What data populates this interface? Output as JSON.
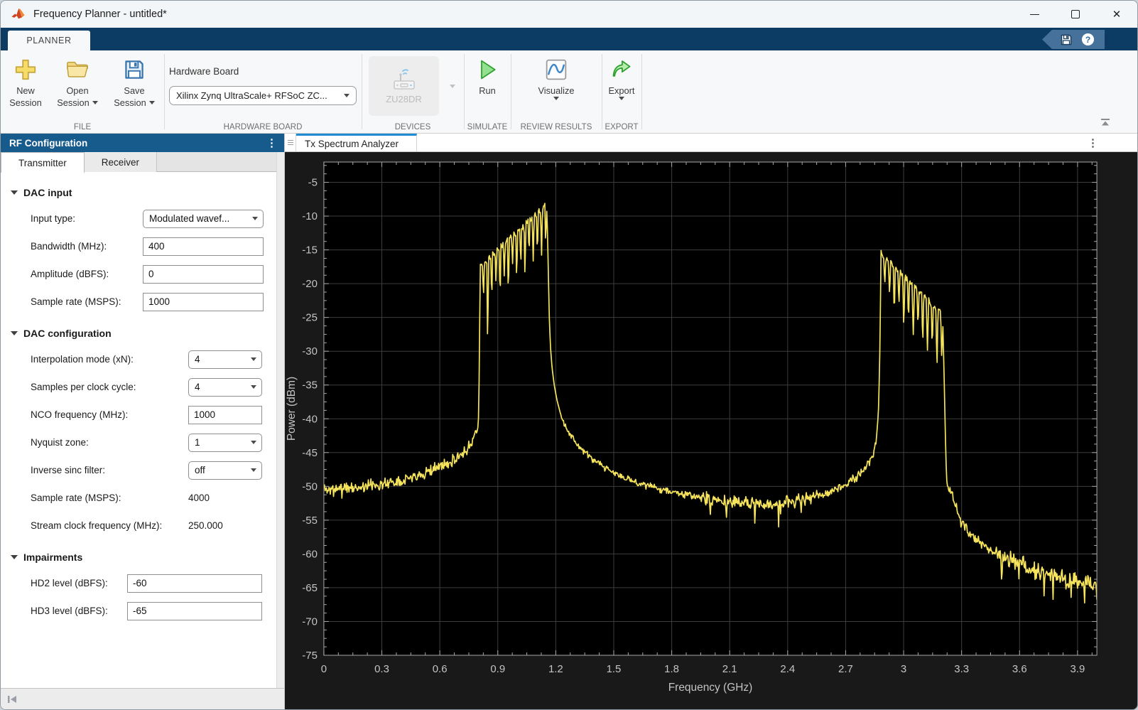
{
  "titlebar": {
    "title": "Frequency Planner - untitled*"
  },
  "ribbon": {
    "tab": "PLANNER",
    "groups": {
      "file": {
        "label": "FILE",
        "new_line1": "New",
        "new_line2": "Session",
        "open_line1": "Open",
        "open_line2": "Session",
        "save_line1": "Save",
        "save_line2": "Session"
      },
      "hardware": {
        "label": "HARDWARE BOARD",
        "field_label": "Hardware Board",
        "selected": "Xilinx Zynq UltraScale+ RFSoC ZC..."
      },
      "devices": {
        "label": "DEVICES",
        "device_name": "ZU28DR"
      },
      "simulate": {
        "label": "SIMULATE",
        "run_label": "Run"
      },
      "review_results": {
        "label": "REVIEW RESULTS",
        "visualize_label": "Visualize"
      },
      "export": {
        "label": "EXPORT",
        "export_label": "Export"
      }
    }
  },
  "left_panel": {
    "title": "RF Configuration",
    "tabs": [
      {
        "label": "Transmitter",
        "active": true
      },
      {
        "label": "Receiver",
        "active": false
      }
    ],
    "sections": [
      {
        "name": "dac-input",
        "title": "DAC input",
        "rows": [
          {
            "name": "input-type",
            "label": "Input type:",
            "type": "combo",
            "value": "Modulated wavef..."
          },
          {
            "name": "bandwidth-mhz",
            "label": "Bandwidth (MHz):",
            "type": "input",
            "value": "400"
          },
          {
            "name": "amplitude-dbfs",
            "label": "Amplitude (dBFS):",
            "type": "input",
            "value": "0"
          },
          {
            "name": "sample-rate-msps",
            "label": "Sample rate (MSPS):",
            "type": "input",
            "value": "1000"
          }
        ]
      },
      {
        "name": "dac-configuration",
        "title": "DAC configuration",
        "rows": [
          {
            "name": "interpolation-mode",
            "label": "Interpolation mode (xN):",
            "type": "combo",
            "value": "4"
          },
          {
            "name": "samples-per-clock-cycle",
            "label": "Samples per clock cycle:",
            "type": "combo",
            "value": "4"
          },
          {
            "name": "nco-frequency-mhz",
            "label": "NCO frequency (MHz):",
            "type": "input",
            "value": "1000"
          },
          {
            "name": "nyquist-zone",
            "label": "Nyquist zone:",
            "type": "combo",
            "value": "1"
          },
          {
            "name": "inverse-sinc-filter",
            "label": "Inverse sinc filter:",
            "type": "combo",
            "value": "off"
          },
          {
            "name": "dac-sample-rate-msps",
            "label": "Sample rate (MSPS):",
            "type": "static",
            "value": "4000"
          },
          {
            "name": "stream-clock-frequency-mhz",
            "label": "Stream clock frequency (MHz):",
            "type": "static",
            "value": "250.000"
          }
        ]
      },
      {
        "name": "impairments",
        "title": "Impairments",
        "rows": [
          {
            "name": "hd2-level-dbfs",
            "label": "HD2 level (dBFS):",
            "type": "input",
            "value": "-60"
          },
          {
            "name": "hd3-level-dbfs",
            "label": "HD3 level (dBFS):",
            "type": "input",
            "value": "-65"
          }
        ]
      }
    ]
  },
  "spectrum_panel": {
    "tab": "Tx Spectrum Analyzer"
  },
  "colors": {
    "ribbon_bar": "#0c3c63",
    "panel_header": "#175a8c",
    "active_tab_accent": "#1e8bd2"
  },
  "chart_data": {
    "type": "line",
    "title": "",
    "xlabel": "Frequency (GHz)",
    "ylabel": "Power (dBm)",
    "xlim": [
      0,
      4.0
    ],
    "ylim": [
      -75,
      -2
    ],
    "xticks": [
      0,
      0.3,
      0.6,
      0.9,
      1.2,
      1.5,
      1.8,
      2.1,
      2.4,
      2.7,
      3,
      3.3,
      3.6,
      3.9
    ],
    "xtick_labels": [
      "0",
      "0.3",
      "0.6",
      "0.9",
      "1.2",
      "1.5",
      "1.8",
      "2.1",
      "2.4",
      "2.7",
      "3",
      "3.3",
      "3.6",
      "3.9"
    ],
    "yticks": [
      -5,
      -10,
      -15,
      -20,
      -25,
      -30,
      -35,
      -40,
      -45,
      -50,
      -55,
      -60,
      -65,
      -70,
      -75
    ],
    "minor_x_step": 0.075,
    "minor_y_step": 1.25,
    "grid": true,
    "legend": false,
    "colors": {
      "trace": "#f5e35c",
      "plot_bg": "#000000",
      "frame_bg": "#191919",
      "grid": "#3d3d3d",
      "axis": "#a8a8a8",
      "text": "#c4c4c4"
    },
    "series": [
      {
        "seed": 11,
        "envelope": [
          [
            0,
            -50.2
          ],
          [
            0.05,
            -50.6
          ],
          [
            0.1,
            -50.1
          ],
          [
            0.16,
            -50.3
          ],
          [
            0.22,
            -49.9
          ],
          [
            0.3,
            -49.6
          ],
          [
            0.38,
            -49.2
          ],
          [
            0.45,
            -48.6
          ],
          [
            0.52,
            -48.0
          ],
          [
            0.58,
            -47.3
          ],
          [
            0.64,
            -46.5
          ],
          [
            0.69,
            -45.7
          ],
          [
            0.72,
            -45.1
          ],
          [
            0.745,
            -44.3
          ],
          [
            0.757,
            -43.6
          ],
          [
            0.764,
            -43.8
          ],
          [
            0.774,
            -42.8
          ],
          [
            0.783,
            -42.2
          ],
          [
            0.79,
            -41.8
          ],
          [
            0.797,
            -41.3
          ],
          [
            0.801,
            -39.5
          ],
          [
            0.804,
            -33.0
          ],
          [
            0.807,
            -24.0
          ],
          [
            0.809,
            -17.6
          ],
          [
            1.152,
            -8.3
          ],
          [
            1.157,
            -12.0
          ],
          [
            1.162,
            -19.0
          ],
          [
            1.167,
            -25.5
          ],
          [
            1.173,
            -29.5
          ],
          [
            1.181,
            -32.5
          ],
          [
            1.192,
            -35.0
          ],
          [
            1.206,
            -37.2
          ],
          [
            1.225,
            -39.3
          ],
          [
            1.25,
            -41.0
          ],
          [
            1.285,
            -42.8
          ],
          [
            1.33,
            -44.4
          ],
          [
            1.39,
            -46.0
          ],
          [
            1.46,
            -47.4
          ],
          [
            1.55,
            -48.7
          ],
          [
            1.65,
            -49.7
          ],
          [
            1.77,
            -50.6
          ],
          [
            1.9,
            -51.4
          ],
          [
            2.03,
            -52.0
          ],
          [
            2.17,
            -52.5
          ],
          [
            2.3,
            -52.7
          ],
          [
            2.42,
            -52.3
          ],
          [
            2.52,
            -51.7
          ],
          [
            2.61,
            -50.9
          ],
          [
            2.69,
            -49.9
          ],
          [
            2.76,
            -48.6
          ],
          [
            2.81,
            -47.1
          ],
          [
            2.845,
            -45.2
          ],
          [
            2.862,
            -42.5
          ],
          [
            2.871,
            -38.0
          ],
          [
            2.877,
            -30.0
          ],
          [
            2.881,
            -21.0
          ],
          [
            2.883,
            -15.6
          ],
          [
            3.202,
            -24.8
          ],
          [
            3.206,
            -29.5
          ],
          [
            3.211,
            -35.5
          ],
          [
            3.215,
            -41.0
          ],
          [
            3.219,
            -46.0
          ],
          [
            3.224,
            -49.6
          ],
          [
            3.23,
            -50.3
          ],
          [
            3.24,
            -50.6
          ],
          [
            3.25,
            -51.3
          ],
          [
            3.262,
            -52.4
          ],
          [
            3.278,
            -53.9
          ],
          [
            3.295,
            -55.1
          ],
          [
            3.315,
            -56.0
          ],
          [
            3.35,
            -57.1
          ],
          [
            3.395,
            -58.3
          ],
          [
            3.45,
            -59.4
          ],
          [
            3.51,
            -60.3
          ],
          [
            3.58,
            -61.3
          ],
          [
            3.66,
            -62.2
          ],
          [
            3.75,
            -63.0
          ],
          [
            3.84,
            -63.7
          ],
          [
            3.93,
            -64.4
          ],
          [
            4.0,
            -64.2
          ]
        ],
        "ramps": [
          {
            "f0": 0.809,
            "f1": 1.152,
            "p0": -17.4,
            "p1": -8.3,
            "depths": [
              4.5,
              11.5,
              5.5,
              4,
              6.5,
              4.5,
              7,
              4,
              6,
              5,
              7.5,
              4.5,
              6.5,
              5.5,
              7,
              5
            ]
          },
          {
            "f0": 2.883,
            "f1": 3.202,
            "p0": -15.4,
            "p1": -24.6,
            "depths": [
              3.5,
              5,
              6.5,
              4.5,
              7,
              5.5,
              7.5,
              5,
              6.5,
              7.5,
              6,
              8,
              6.5
            ]
          }
        ],
        "noise_segments": [
          [
            0,
            0.795,
            1.0
          ],
          [
            1.23,
            1.95,
            0.6
          ],
          [
            1.95,
            2.56,
            1.1
          ],
          [
            2.56,
            2.865,
            0.8
          ],
          [
            3.23,
            3.5,
            1.0
          ],
          [
            3.5,
            4.0,
            1.5
          ]
        ]
      }
    ]
  }
}
